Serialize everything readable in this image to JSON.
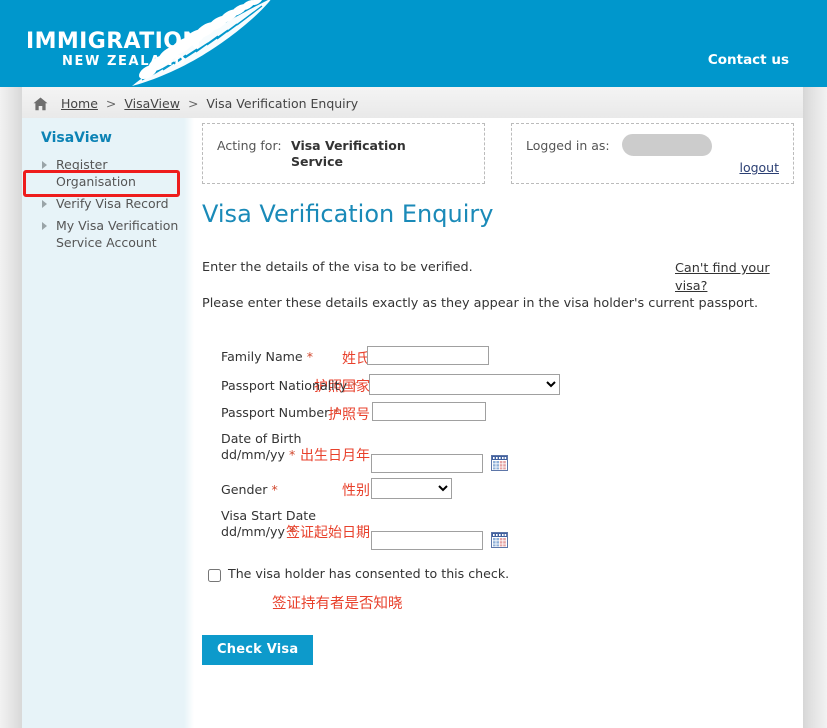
{
  "header": {
    "logo_line1": "IMMIGRATION",
    "logo_line2": "NEW ZEALAND",
    "contact_link": "Contact us",
    "brand_color": "#0097cc"
  },
  "breadcrumb": {
    "home_icon": "home-icon",
    "items": [
      {
        "label": "Home",
        "link": true
      },
      {
        "label": "VisaView",
        "link": true
      },
      {
        "label": "Visa Verification Enquiry",
        "link": false
      }
    ],
    "separator": ">"
  },
  "sidebar": {
    "title": "VisaView",
    "items": [
      {
        "label": "Register Organisation",
        "highlighted": false
      },
      {
        "label": "Verify Visa Record",
        "highlighted": true
      },
      {
        "label": "My Visa Verification Service Account",
        "highlighted": false
      }
    ],
    "highlight_color": "#ee1c1c"
  },
  "acting_panel": {
    "label": "Acting for:",
    "value": "Visa Verification Service"
  },
  "login_panel": {
    "label": "Logged in as:",
    "value": "",
    "logout_label": "logout"
  },
  "main": {
    "title": "Visa Verification Enquiry",
    "intro_line_1": "Enter the details of the visa to be verified.",
    "intro_line_2": "Please enter these details exactly as they appear in the visa holder's current passport.",
    "cant_find_link": "Can't find your visa?"
  },
  "form": {
    "required_marker": "*",
    "fields": [
      {
        "id": "family-name",
        "cn_label": "姓氏",
        "en_label": "Family Name",
        "required": true,
        "control": "text",
        "value": "",
        "placeholder": ""
      },
      {
        "id": "passport-nationality",
        "cn_label": "护照国家",
        "en_label": "Passport Nationality",
        "required": true,
        "control": "select",
        "value": "",
        "options": [
          ""
        ]
      },
      {
        "id": "passport-number",
        "cn_label": "护照号",
        "en_label": "Passport Number",
        "required": true,
        "control": "text",
        "value": "",
        "placeholder": ""
      },
      {
        "id": "date-of-birth",
        "cn_label": "出生日月年",
        "en_label": "Date of Birth",
        "en_label_2": "dd/mm/yy",
        "required": true,
        "control": "date",
        "value": "",
        "placeholder": "",
        "calendar_icon": "calendar-icon"
      },
      {
        "id": "gender",
        "cn_label": "性别",
        "en_label": "Gender",
        "required": true,
        "control": "select",
        "value": "",
        "options": [
          ""
        ]
      },
      {
        "id": "visa-start-date",
        "cn_label": "签证起始日期",
        "en_label": "Visa Start Date",
        "en_label_2": "dd/mm/yy",
        "required": true,
        "control": "date",
        "value": "",
        "placeholder": "",
        "calendar_icon": "calendar-icon"
      }
    ],
    "consent": {
      "label": "The visa holder has consented to this check.",
      "cn_note": "签证持有者是否知晓",
      "checked": false
    },
    "submit_label": "Check Visa",
    "submit_color": "#0d9acb",
    "annotation_color": "#e8412c"
  }
}
